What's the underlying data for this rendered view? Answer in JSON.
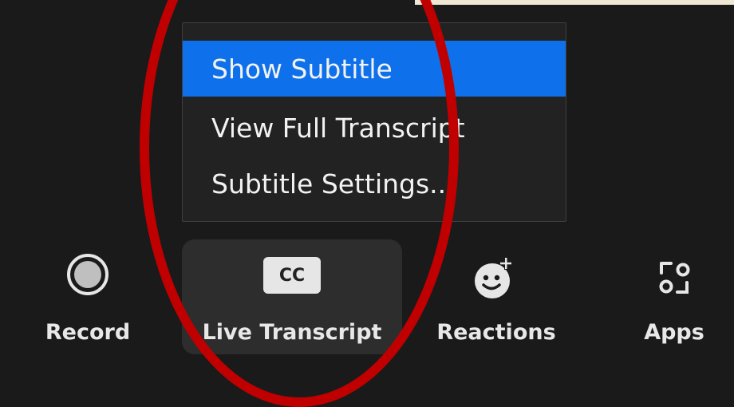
{
  "menu": {
    "items": [
      {
        "label": "Show Subtitle",
        "selected": true
      },
      {
        "label": "View Full Transcript",
        "selected": false
      },
      {
        "label": "Subtitle Settings...",
        "selected": false
      }
    ]
  },
  "toolbar": {
    "record_label": "Record",
    "live_transcript_label": "Live Transcript",
    "cc_text": "CC",
    "reactions_label": "Reactions",
    "apps_label": "Apps"
  },
  "icons": {
    "record": "record-icon",
    "cc": "closed-caption-icon",
    "reactions": "emoji-add-icon",
    "apps": "apps-icon"
  },
  "colors": {
    "background": "#1a1a1a",
    "menu_bg": "#222222",
    "selected": "#0e71eb",
    "annotation": "#c00000"
  }
}
